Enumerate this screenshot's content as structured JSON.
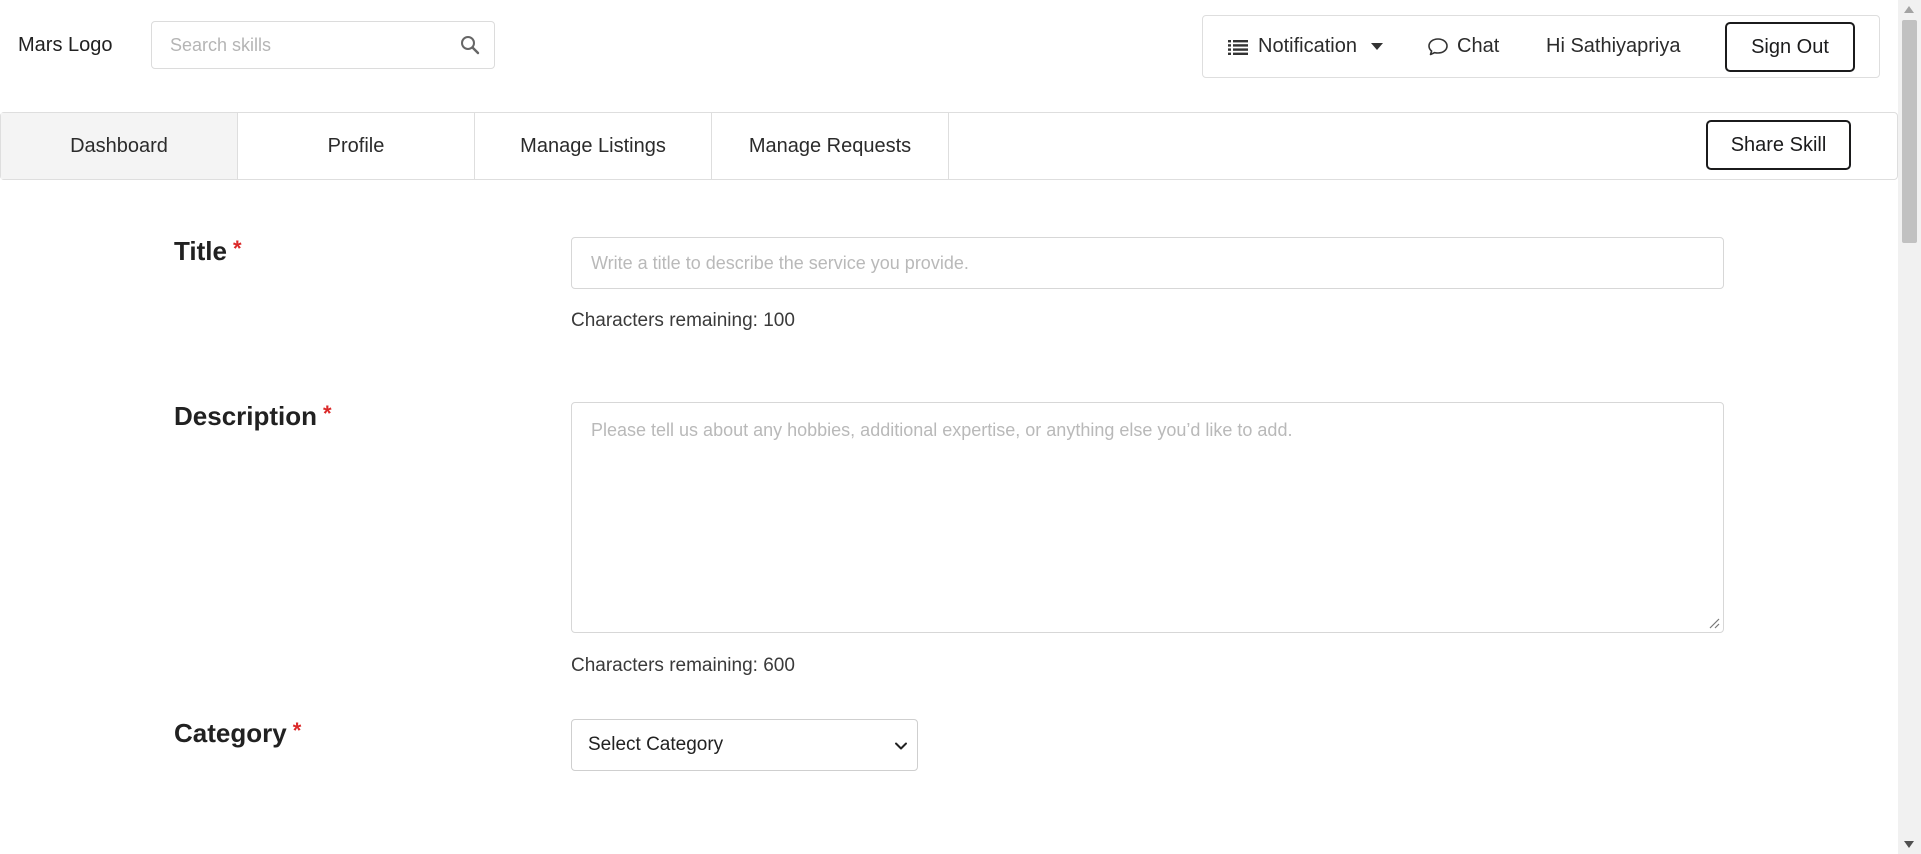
{
  "header": {
    "logo_text": "Mars Logo",
    "search_placeholder": "Search skills",
    "notification_label": "Notification",
    "chat_label": "Chat",
    "greeting": "Hi Sathiyapriya",
    "signout_label": "Sign Out"
  },
  "tabs": [
    {
      "label": "Dashboard",
      "active": true
    },
    {
      "label": "Profile",
      "active": false
    },
    {
      "label": "Manage Listings",
      "active": false
    },
    {
      "label": "Manage Requests",
      "active": false
    }
  ],
  "share_label": "Share Skill",
  "form": {
    "required_mark": "*",
    "title": {
      "label": "Title",
      "value": "",
      "placeholder": "Write a title to describe the service you provide.",
      "remaining": "Characters remaining: 100"
    },
    "description": {
      "label": "Description",
      "value": "",
      "placeholder": "Please tell us about any hobbies, additional expertise, or anything else you’d like to add.",
      "remaining": "Characters remaining: 600"
    },
    "category": {
      "label": "Category",
      "selected": "Select Category"
    }
  },
  "colors": {
    "required": "#db2828",
    "button_border": "#1b1b1c",
    "active_tab_bg": "#f4f4f4",
    "border": "#dedede"
  },
  "icons": [
    "search-icon",
    "list-icon",
    "caret-down-icon",
    "chat-icon",
    "chevron-down-icon",
    "resize-grip-icon"
  ]
}
